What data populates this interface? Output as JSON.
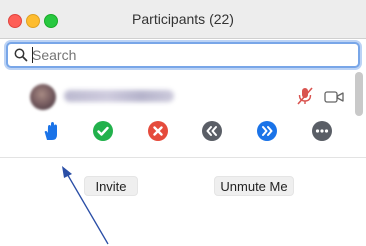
{
  "window": {
    "title": "Participants (22)"
  },
  "search": {
    "placeholder": "Search"
  },
  "participant": {
    "name": "Eugene Fabian Ortiz"
  },
  "actions": {
    "invite_label": "Invite",
    "unmute_label": "Unmute Me"
  },
  "icons": {
    "reactions": [
      "raise-hand-icon",
      "yes-check-icon",
      "no-x-icon",
      "go-slower-icon",
      "go-faster-icon",
      "more-icon"
    ],
    "row": [
      "mic-muted-icon",
      "video-camera-icon"
    ]
  },
  "colors": {
    "accent_blue": "#1a73e8",
    "green": "#22b14c",
    "red": "#e54b3c",
    "gray": "#5a5e66"
  }
}
